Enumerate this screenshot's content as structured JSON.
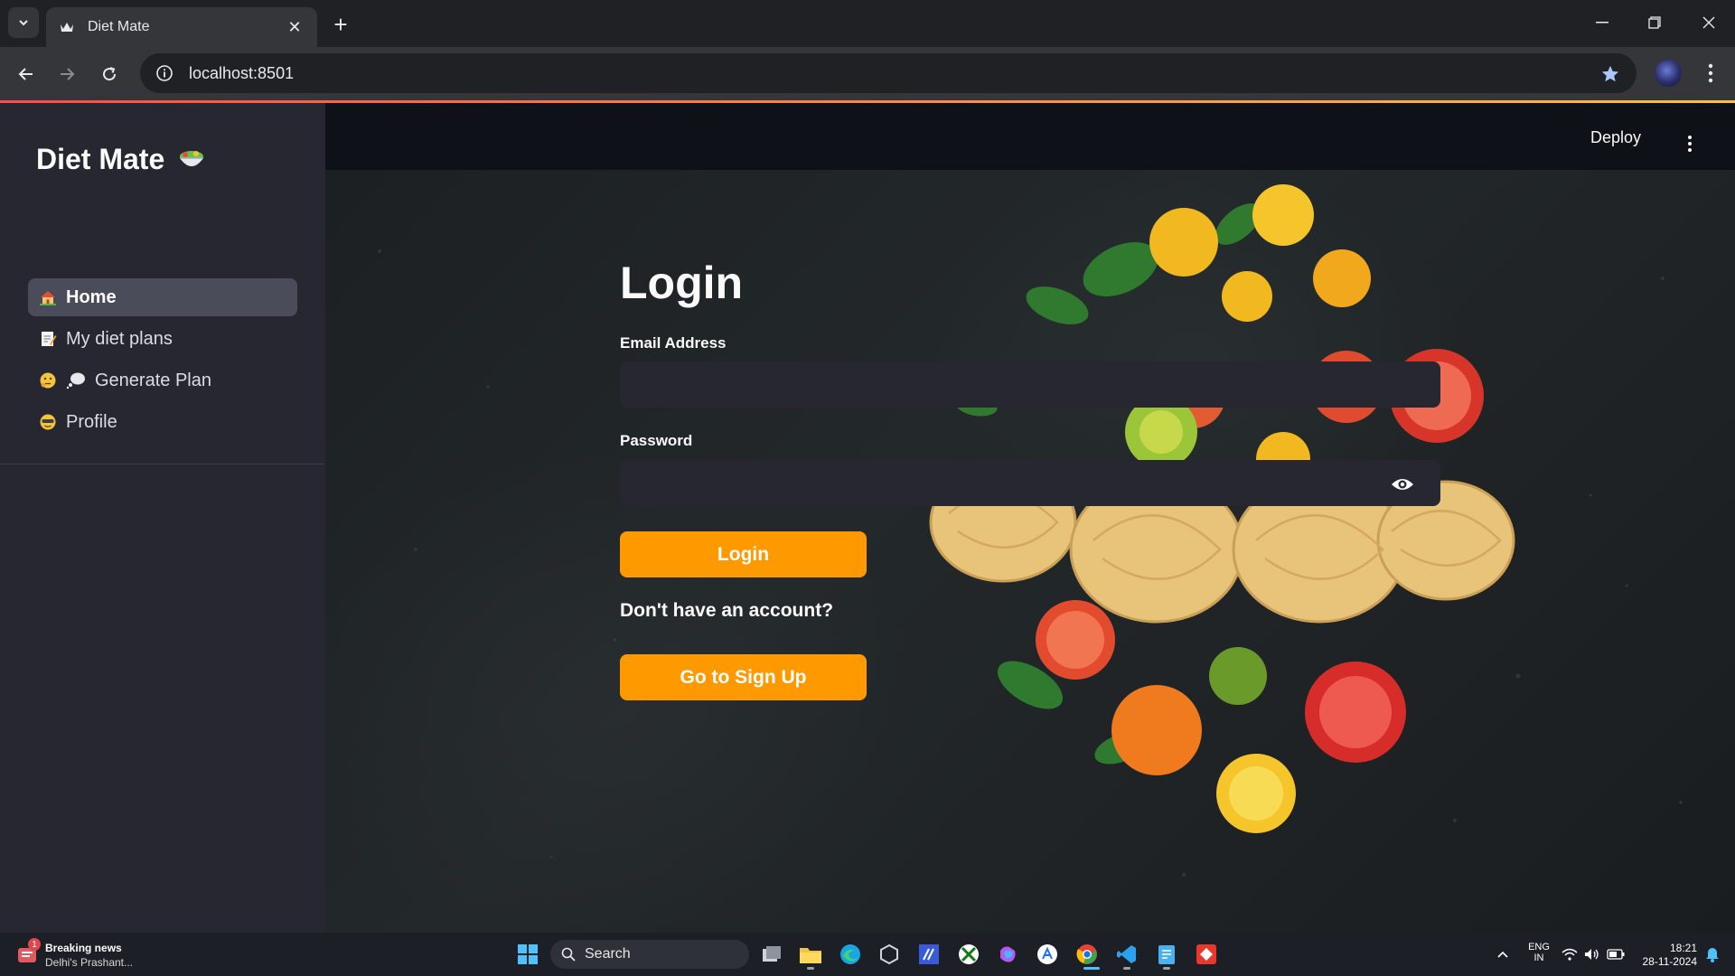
{
  "browser": {
    "tab_title": "Diet Mate",
    "url": "localhost:8501"
  },
  "sidebar": {
    "app_title": "Diet Mate",
    "nav": [
      {
        "label": "Home",
        "icon": "house-icon",
        "active": true
      },
      {
        "label": "My diet plans",
        "icon": "memo-icon",
        "active": false
      },
      {
        "label": "Generate Plan",
        "icon": "thinking-face-icon",
        "active": false
      },
      {
        "label": "Profile",
        "icon": "face-icon",
        "active": false
      }
    ]
  },
  "header": {
    "deploy_label": "Deploy"
  },
  "login": {
    "title": "Login",
    "email_label": "Email Address",
    "email_value": "",
    "password_label": "Password",
    "password_value": "",
    "login_button": "Login",
    "no_account_text": "Don't have an account?",
    "signup_button": "Go to Sign Up"
  },
  "taskbar": {
    "news_title": "Breaking news",
    "news_sub": "Delhi's Prashant...",
    "news_badge": "1",
    "search_label": "Search",
    "lang_line1": "ENG",
    "lang_line2": "IN",
    "time": "18:21",
    "date": "28-11-2024"
  },
  "colors": {
    "accent": "#ff9900",
    "sidebar_bg": "#262730",
    "header_bg": "#0e1117",
    "input_bg": "#262730",
    "active_nav_bg": "#4a4c5a"
  }
}
